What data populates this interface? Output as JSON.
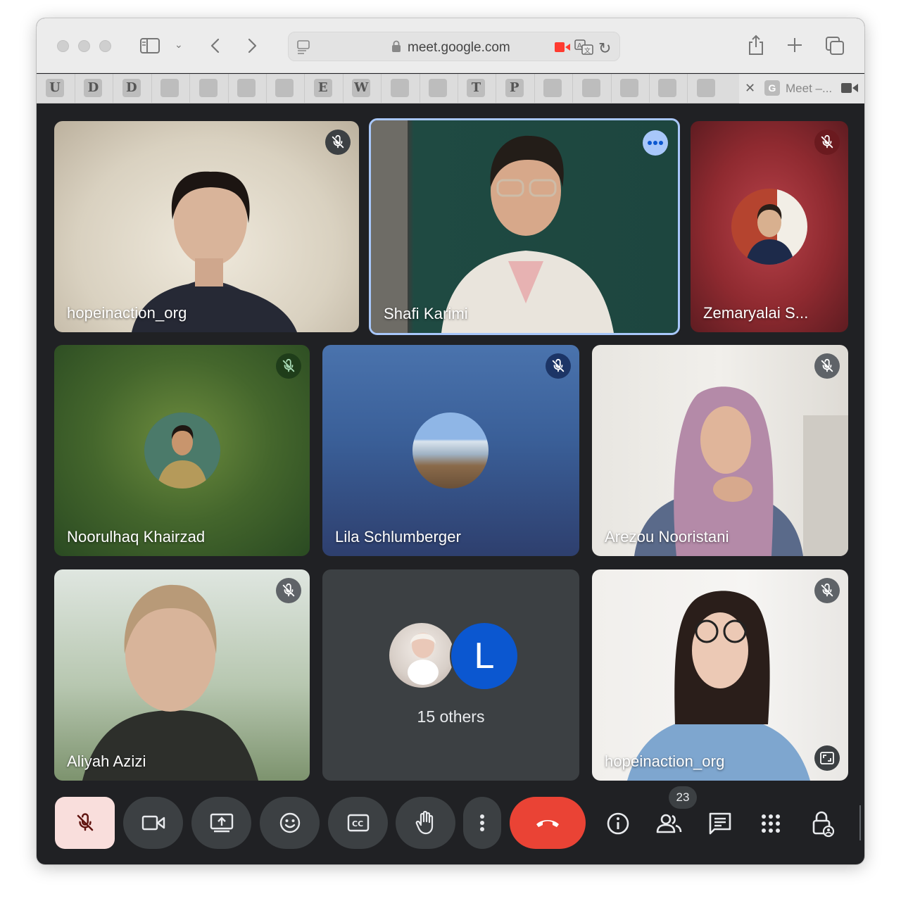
{
  "browser": {
    "url": "meet.google.com",
    "favorites": [
      "U",
      "D",
      "D",
      "",
      "",
      "",
      "",
      "E",
      "W",
      "",
      "",
      "T",
      "P",
      "",
      "",
      "",
      "",
      ""
    ],
    "active_tab": {
      "title": "Meet –..."
    }
  },
  "meeting": {
    "tiles": [
      {
        "name": "hopeinaction_org",
        "muted": true
      },
      {
        "name": "Shafi Karimi",
        "speaking": true
      },
      {
        "name": "Zemaryalai S...",
        "muted": true
      },
      {
        "name": "Noorulhaq Khairzad",
        "muted": true
      },
      {
        "name": "Lila Schlumberger",
        "muted": true
      },
      {
        "name": "Arezou Nooristani",
        "muted": true
      },
      {
        "name": "Aliyah Azizi",
        "muted": true
      },
      {
        "name": "15 others",
        "avatar_letter": "L"
      },
      {
        "name": "hopeinaction_org",
        "muted": true
      }
    ],
    "people_count": "23"
  },
  "colors": {
    "meet_bg": "#202124",
    "active_border": "#a8c7fa",
    "end_call": "#ea4335",
    "mic_off_bg": "#f9dedc"
  }
}
